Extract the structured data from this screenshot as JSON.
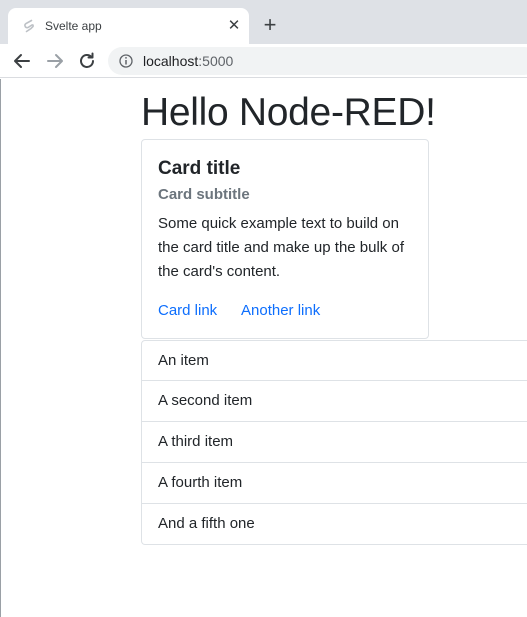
{
  "browser": {
    "tab": {
      "title": "Svelte app",
      "close_glyph": "✕"
    },
    "new_tab_glyph": "+",
    "address_bar": {
      "host": "localhost",
      "port": ":5000"
    },
    "icons": [
      "svelte-favicon-icon",
      "close-icon",
      "plus-icon",
      "back-arrow-icon",
      "forward-arrow-icon",
      "reload-icon",
      "info-icon"
    ]
  },
  "page": {
    "heading": "Hello Node-RED!",
    "card": {
      "title": "Card title",
      "subtitle": "Card subtitle",
      "text": "Some quick example text to build on the card title and make up the bulk of the card's content.",
      "links": [
        "Card link",
        "Another link"
      ]
    },
    "list": [
      "An item",
      "A second item",
      "A third item",
      "A fourth item",
      "And a fifth one"
    ]
  },
  "colors": {
    "link": "#0d6efd",
    "text": "#212529",
    "muted": "#6c757d",
    "border": "#dee2e6",
    "tabstrip": "#dee1e6"
  }
}
